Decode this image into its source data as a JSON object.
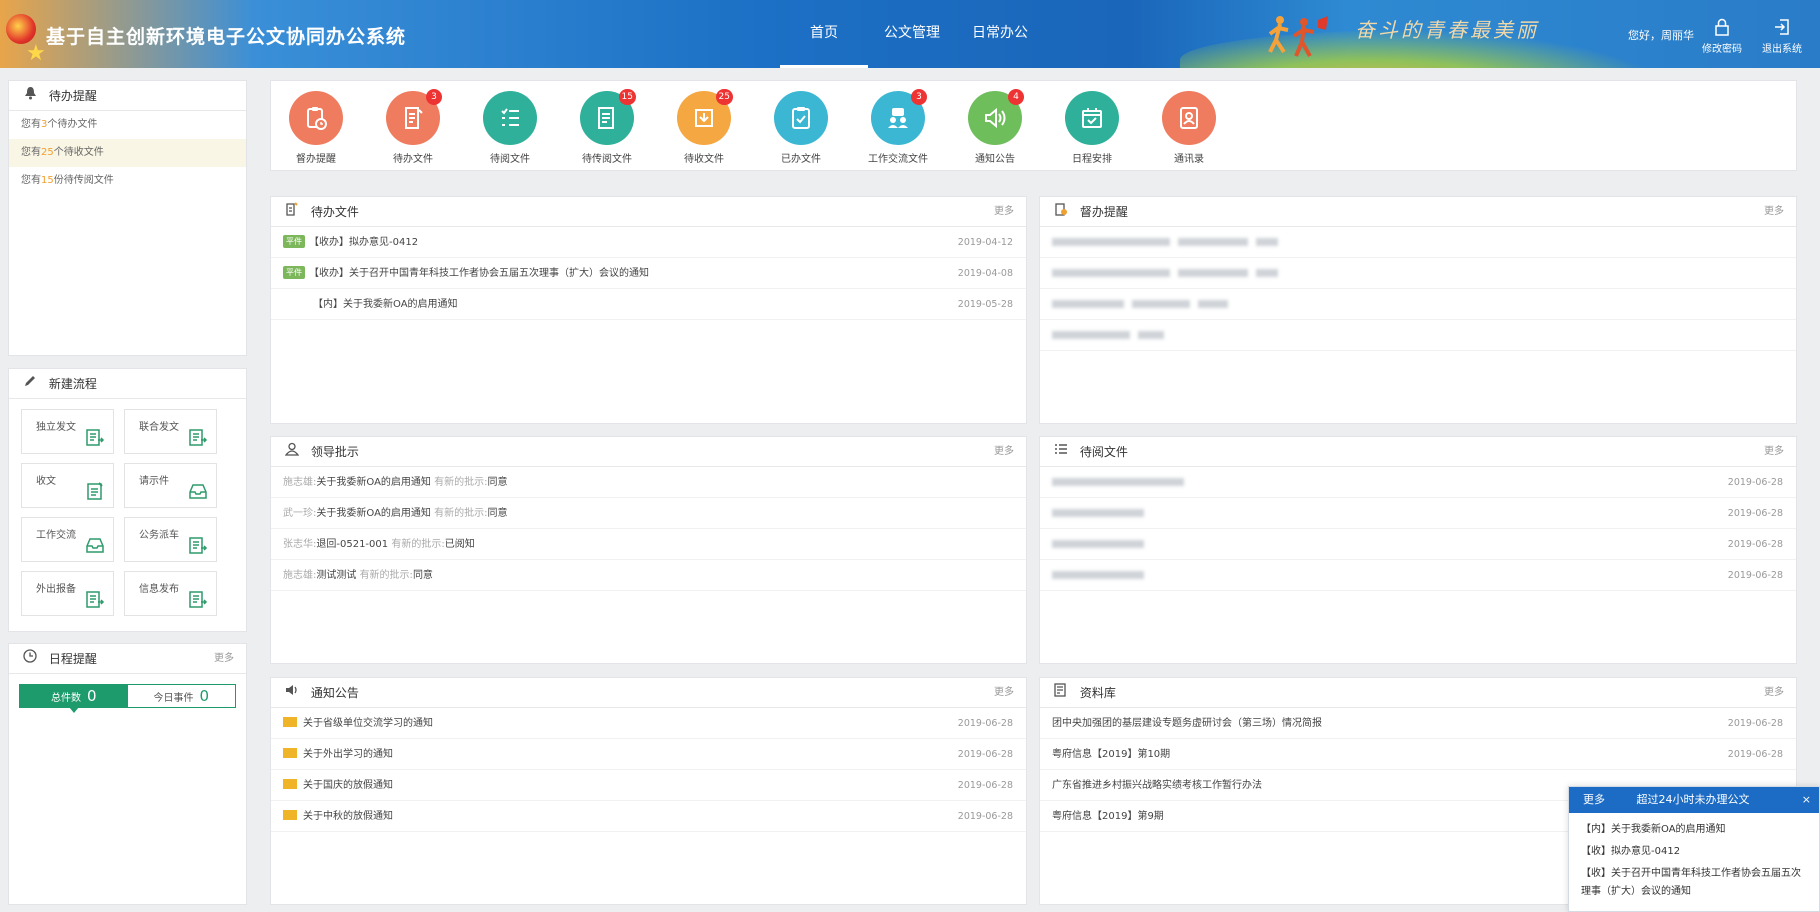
{
  "header": {
    "title": "基于自主创新环境电子公文协同办公系统",
    "nav": [
      "首页",
      "公文管理",
      "日常办公"
    ],
    "slogan": "奋斗的青春最美丽",
    "greeting": "您好，周丽华",
    "change_password": "修改密码",
    "logout": "退出系统"
  },
  "left": {
    "todo_title": "待办提醒",
    "todo_items": [
      {
        "pre": "您有",
        "num": "3",
        "post": "个待办文件"
      },
      {
        "pre": "您有",
        "num": "25",
        "post": "个待收文件"
      },
      {
        "pre": "您有",
        "num": "15",
        "post": "份待传阅文件"
      }
    ],
    "flow_title": "新建流程",
    "flows": [
      "独立发文",
      "联合发文",
      "收文",
      "请示件",
      "工作交流",
      "公务派车",
      "外出报备",
      "信息发布"
    ],
    "sched_title": "日程提醒",
    "sched_more": "更多",
    "sched_total_label": "总件数",
    "sched_total": "0",
    "sched_today_label": "今日事件",
    "sched_today": "0"
  },
  "quick": [
    {
      "label": "督办提醒",
      "badge": "",
      "color": "#ef7c5e"
    },
    {
      "label": "待办文件",
      "badge": "3",
      "color": "#ef7c5e"
    },
    {
      "label": "待阅文件",
      "badge": "",
      "color": "#2eb09a"
    },
    {
      "label": "待传阅文件",
      "badge": "15",
      "color": "#2eb09a"
    },
    {
      "label": "待收文件",
      "badge": "25",
      "color": "#f5a742"
    },
    {
      "label": "已办文件",
      "badge": "",
      "color": "#3bb7d4"
    },
    {
      "label": "工作交流文件",
      "badge": "3",
      "color": "#3bb7d4"
    },
    {
      "label": "通知公告",
      "badge": "4",
      "color": "#6fbe5c"
    },
    {
      "label": "日程安排",
      "badge": "",
      "color": "#2eb09a"
    },
    {
      "label": "通讯录",
      "badge": "",
      "color": "#ef7c5e"
    }
  ],
  "pending": {
    "title": "待办文件",
    "more": "更多",
    "tag": "平件",
    "rows": [
      {
        "text": "【收办】拟办意见-0412",
        "date": "2019-04-12"
      },
      {
        "text": "【收办】关于召开中国青年科技工作者协会五届五次理事（扩大）会议的通知",
        "date": "2019-04-08"
      },
      {
        "text": "【内】关于我委新OA的启用通知",
        "date": "2019-05-28"
      }
    ]
  },
  "supervise": {
    "title": "督办提醒",
    "more": "更多"
  },
  "leader": {
    "title": "领导批示",
    "more": "更多",
    "rows": [
      {
        "who": "施志雄:",
        "doc": "关于我委新OA的启用通知",
        "mid": "有新的批示:",
        "val": "同意"
      },
      {
        "who": "武一珍:",
        "doc": "关于我委新OA的启用通知",
        "mid": "有新的批示:",
        "val": "同意"
      },
      {
        "who": "张志华:",
        "doc": "退回-0521-001",
        "mid": "有新的批示:",
        "val": "已阅知"
      },
      {
        "who": "施志雄:",
        "doc": "测试测试",
        "mid": "有新的批示:",
        "val": "同意"
      }
    ]
  },
  "toread": {
    "title": "待阅文件",
    "more": "更多",
    "dates": [
      "2019-06-28",
      "2019-06-28",
      "2019-06-28",
      "2019-06-28"
    ]
  },
  "notice": {
    "title": "通知公告",
    "more": "更多",
    "rows": [
      {
        "text": "关于省级单位交流学习的通知",
        "date": "2019-06-28"
      },
      {
        "text": "关于外出学习的通知",
        "date": "2019-06-28"
      },
      {
        "text": "关于国庆的放假通知",
        "date": "2019-06-28"
      },
      {
        "text": "关于中秋的放假通知",
        "date": "2019-06-28"
      }
    ]
  },
  "library": {
    "title": "资料库",
    "more": "更多",
    "rows": [
      {
        "text": "团中央加强团的基层建设专题务虚研讨会（第三场）情况简报",
        "date": "2019-06-28"
      },
      {
        "text": "粤府信息【2019】第10期",
        "date": "2019-06-28"
      },
      {
        "text": "广东省推进乡村振兴战略实绩考核工作暂行办法",
        "date": ""
      },
      {
        "text": "粤府信息【2019】第9期",
        "date": ""
      }
    ]
  },
  "popup": {
    "more": "更多",
    "title": "超过24小时未办理公文",
    "close": "×",
    "items": [
      "【内】关于我委新OA的启用通知",
      "【收】拟办意见-0412",
      "【收】关于召开中国青年科技工作者协会五届五次理事（扩大）会议的通知"
    ]
  }
}
